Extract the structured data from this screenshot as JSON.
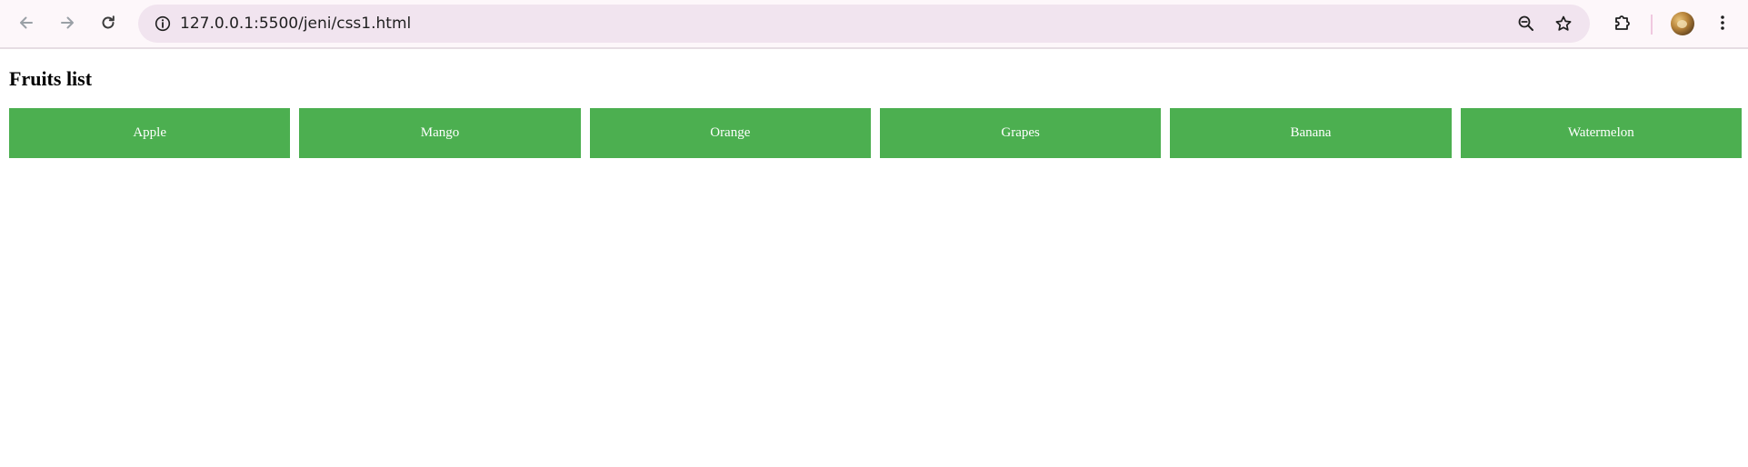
{
  "browser": {
    "url": "127.0.0.1:5500/jeni/css1.html",
    "icons": {
      "back": "arrow-left-icon",
      "forward": "arrow-right-icon",
      "reload": "reload-icon",
      "site_info": "info-icon",
      "zoom": "zoom-out-icon",
      "bookmark": "star-icon",
      "extensions": "puzzle-icon",
      "profile": "avatar",
      "menu": "kebab-menu-icon"
    }
  },
  "page": {
    "title": "Fruits list",
    "fruits": [
      "Apple",
      "Mango",
      "Orange",
      "Grapes",
      "Banana",
      "Watermelon"
    ],
    "colors": {
      "fruit_background": "#4caf50",
      "fruit_text": "#ffffff"
    }
  }
}
